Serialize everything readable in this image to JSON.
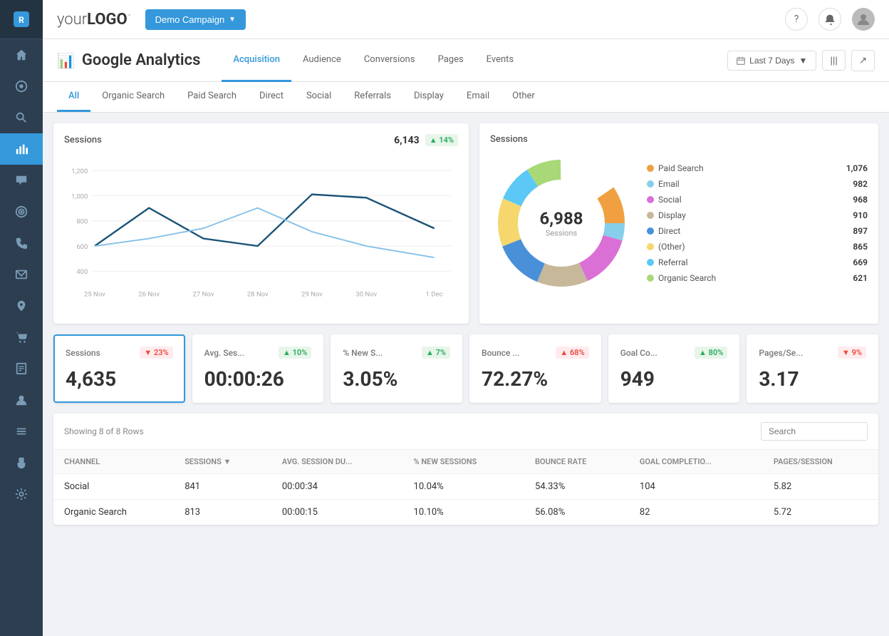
{
  "sidebar": {
    "icons": [
      {
        "name": "home-icon",
        "symbol": "⌂"
      },
      {
        "name": "dashboard-icon",
        "symbol": "◉"
      },
      {
        "name": "search-icon",
        "symbol": "🔍"
      },
      {
        "name": "analytics-icon",
        "symbol": "📊",
        "active": true
      },
      {
        "name": "chat-icon",
        "symbol": "💬"
      },
      {
        "name": "targeting-icon",
        "symbol": "🎯"
      },
      {
        "name": "phone-icon",
        "symbol": "📞"
      },
      {
        "name": "email-icon",
        "symbol": "✉"
      },
      {
        "name": "location-icon",
        "symbol": "📍"
      },
      {
        "name": "cart-icon",
        "symbol": "🛒"
      },
      {
        "name": "reports-icon",
        "symbol": "📋"
      },
      {
        "name": "users-icon",
        "symbol": "👤"
      },
      {
        "name": "list-icon",
        "symbol": "☰"
      },
      {
        "name": "plugin-icon",
        "symbol": "🔌"
      },
      {
        "name": "settings-icon",
        "symbol": "⚙"
      }
    ]
  },
  "topnav": {
    "logo": "your LOGO",
    "campaign_label": "Demo Campaign",
    "help_label": "?",
    "bell_label": "🔔"
  },
  "page_header": {
    "title": "Google Analytics",
    "tabs": [
      {
        "label": "Acquisition",
        "active": true
      },
      {
        "label": "Audience",
        "active": false
      },
      {
        "label": "Conversions",
        "active": false
      },
      {
        "label": "Pages",
        "active": false
      },
      {
        "label": "Events",
        "active": false
      }
    ],
    "date_range": "Last 7 Days",
    "columns_label": "|||",
    "share_label": "↗"
  },
  "sub_tabs": [
    {
      "label": "All",
      "active": true
    },
    {
      "label": "Organic Search",
      "active": false
    },
    {
      "label": "Paid Search",
      "active": false
    },
    {
      "label": "Direct",
      "active": false
    },
    {
      "label": "Social",
      "active": false
    },
    {
      "label": "Referrals",
      "active": false
    },
    {
      "label": "Display",
      "active": false
    },
    {
      "label": "Email",
      "active": false
    },
    {
      "label": "Other",
      "active": false
    }
  ],
  "line_chart": {
    "title": "Sessions",
    "value": "6,143",
    "badge": "▲ 14%",
    "badge_type": "up",
    "y_labels": [
      "1,200",
      "1,000",
      "800",
      "600",
      "400"
    ],
    "x_labels": [
      "25 Nov",
      "26 Nov",
      "27 Nov",
      "28 Nov",
      "29 Nov",
      "30 Nov",
      "1 Dec"
    ]
  },
  "donut_chart": {
    "title": "Sessions",
    "center_value": "6,988",
    "center_label": "Sessions",
    "segments": [
      {
        "label": "Paid Search",
        "value": "1,076",
        "color": "#f0a040"
      },
      {
        "label": "Email",
        "value": "982",
        "color": "#87ceeb"
      },
      {
        "label": "Social",
        "value": "968",
        "color": "#da70d6"
      },
      {
        "label": "Display",
        "value": "910",
        "color": "#c8b89a"
      },
      {
        "label": "Direct",
        "value": "897",
        "color": "#4a90d9"
      },
      {
        "label": "(Other)",
        "value": "865",
        "color": "#f5d76e"
      },
      {
        "label": "Referral",
        "value": "669",
        "color": "#5bc8f5"
      },
      {
        "label": "Organic Search",
        "value": "621",
        "color": "#a8d878"
      }
    ]
  },
  "metric_cards": [
    {
      "label": "Sessions",
      "value": "4,635",
      "badge": "▼ 23%",
      "badge_type": "down",
      "selected": true
    },
    {
      "label": "Avg. Ses...",
      "value": "00:00:26",
      "badge": "▲ 10%",
      "badge_type": "up",
      "selected": false
    },
    {
      "label": "% New S...",
      "value": "3.05%",
      "badge": "▲ 7%",
      "badge_type": "up",
      "selected": false
    },
    {
      "label": "Bounce ...",
      "value": "72.27%",
      "badge": "▲ 68%",
      "badge_type": "down",
      "selected": false
    },
    {
      "label": "Goal Co...",
      "value": "949",
      "badge": "▲ 80%",
      "badge_type": "up",
      "selected": false
    },
    {
      "label": "Pages/Se...",
      "value": "3.17",
      "badge": "▼ 9%",
      "badge_type": "down",
      "selected": false
    }
  ],
  "table": {
    "row_info": "Showing 8 of 8 Rows",
    "search_placeholder": "Search",
    "columns": [
      {
        "label": "CHANNEL",
        "sortable": false
      },
      {
        "label": "SESSIONS",
        "sortable": true
      },
      {
        "label": "AVG. SESSION DU...",
        "sortable": false
      },
      {
        "label": "% NEW SESSIONS",
        "sortable": false
      },
      {
        "label": "BOUNCE RATE",
        "sortable": false
      },
      {
        "label": "GOAL COMPLETIO...",
        "sortable": false
      },
      {
        "label": "PAGES/SESSION",
        "sortable": false
      }
    ],
    "rows": [
      {
        "channel": "Social",
        "sessions": "841",
        "avg_session": "00:00:34",
        "new_sessions": "10.04%",
        "bounce_rate": "54.33%",
        "goal_completions": "104",
        "pages_session": "5.82"
      },
      {
        "channel": "Organic Search",
        "sessions": "813",
        "avg_session": "00:00:15",
        "new_sessions": "10.10%",
        "bounce_rate": "56.08%",
        "goal_completions": "82",
        "pages_session": "5.72"
      }
    ]
  }
}
